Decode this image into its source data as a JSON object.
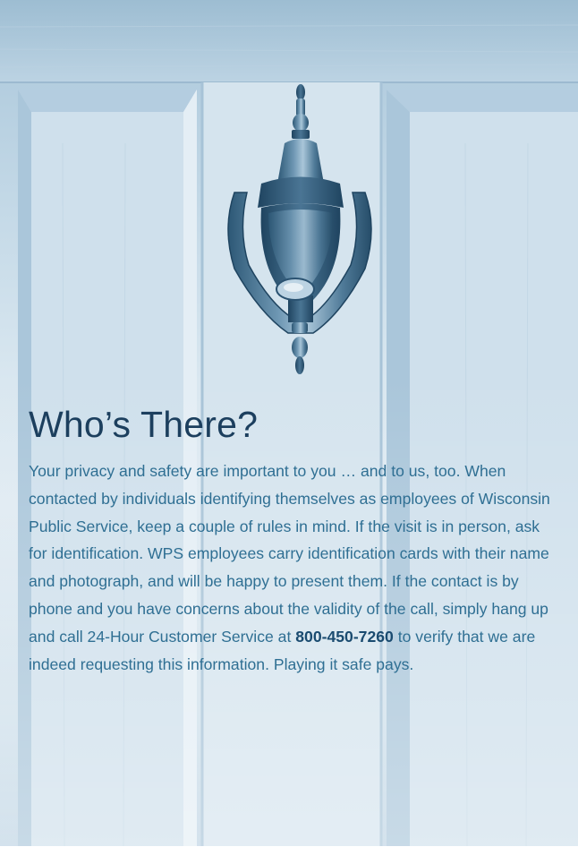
{
  "article": {
    "heading": "Who’s There?",
    "body_before_phone": "Your privacy and safety are important to you … and to us, too. When contacted by individuals identifying themselves as employees of Wisconsin Public Service, keep a couple of rules in mind. If the visit is in person, ask for identification. WPS employees carry identification cards with their name and photograph, and will be happy to present them. If the contact is by phone and you have concerns about the validity of the call, simply hang up and call 24-Hour Customer Service at ",
    "phone_number": "800-450-7260",
    "body_after_phone": " to verify that we are indeed requesting this information. Playing it safe pays."
  },
  "colors": {
    "heading": "#1c3f5e",
    "body_text": "#2f6f93",
    "phone_text": "#1a4b70",
    "door_light": "#dfeaf2",
    "door_dark": "#8fb0c8"
  },
  "icons": {
    "photo": "door-knocker-icon"
  }
}
